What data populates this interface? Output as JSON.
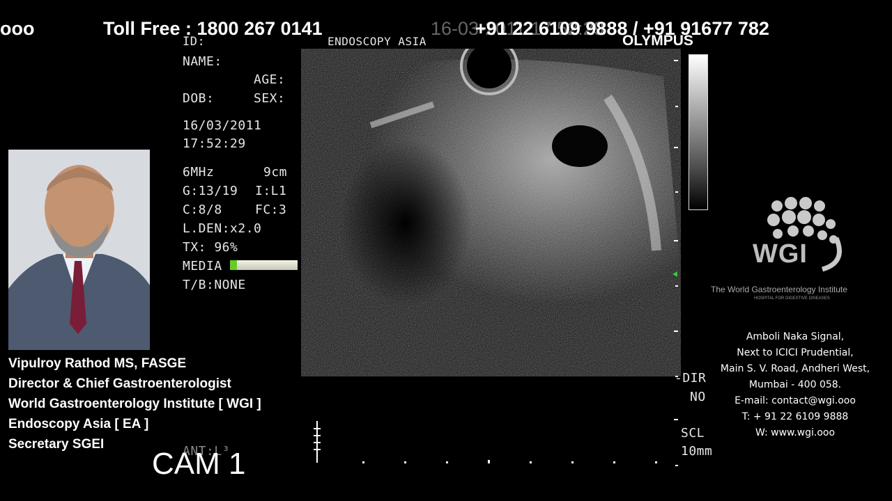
{
  "ticker": {
    "left_fragment": "ooo",
    "toll_free": "Toll Free : 1800 267 0141",
    "numbers": "+91 22 6109 9888  /  +91 91677 782"
  },
  "scanner": {
    "header_time_overlay": "16-03-2011 17:52:29",
    "id_label": "ID:",
    "site": "ENDOSCOPY ASIA",
    "brand": "OLYMPUS",
    "name_label": "NAME:",
    "age_label": "AGE:",
    "dob_label": "DOB:",
    "sex_label": "SEX:",
    "date": "16/03/2011",
    "time": "17:52:29",
    "frequency": "6MHz",
    "depth": "9cm",
    "gain": "G:13/19",
    "i_value": "I:L1",
    "contrast": "C:8/8",
    "fc": "FC:3",
    "line_density": "L.DEN:x2.0",
    "tx": "TX: 96%",
    "media_label": "MEDIA",
    "media_fill_fraction": 0.1,
    "tb": "T/B:NONE",
    "dir_label": "-DIR",
    "dir_value": "NO",
    "scl_label": "SCL",
    "scl_value": "10mm",
    "bottom_overlay": "ANT:L³"
  },
  "camera": {
    "label": "CAM 1"
  },
  "presenter": {
    "photo_icon": "portrait-photo",
    "lines": [
      "Vipulroy Rathod MS, FASGE",
      "Director & Chief Gastroenterologist",
      "World Gastroenterology Institute [ WGI ]",
      "Endoscopy Asia [ EA ]",
      "Secretary SGEI"
    ]
  },
  "logo": {
    "letters": "WGI",
    "name": "The World Gastroenterology Institute",
    "tagline": "HOSPITAL FOR DIGESTIVE DISEASES"
  },
  "address": {
    "lines": [
      "Amboli Naka Signal,",
      "Next to ICICI Prudential,",
      "Main S. V. Road, Andheri West,",
      "Mumbai - 400 058.",
      "E-mail: contact@wgi.ooo",
      "T: + 91 22 6109 9888",
      "W: www.wgi.ooo"
    ]
  },
  "colors": {
    "background": "#000000",
    "media_fill": "#66cc22",
    "text": "#ffffff"
  }
}
